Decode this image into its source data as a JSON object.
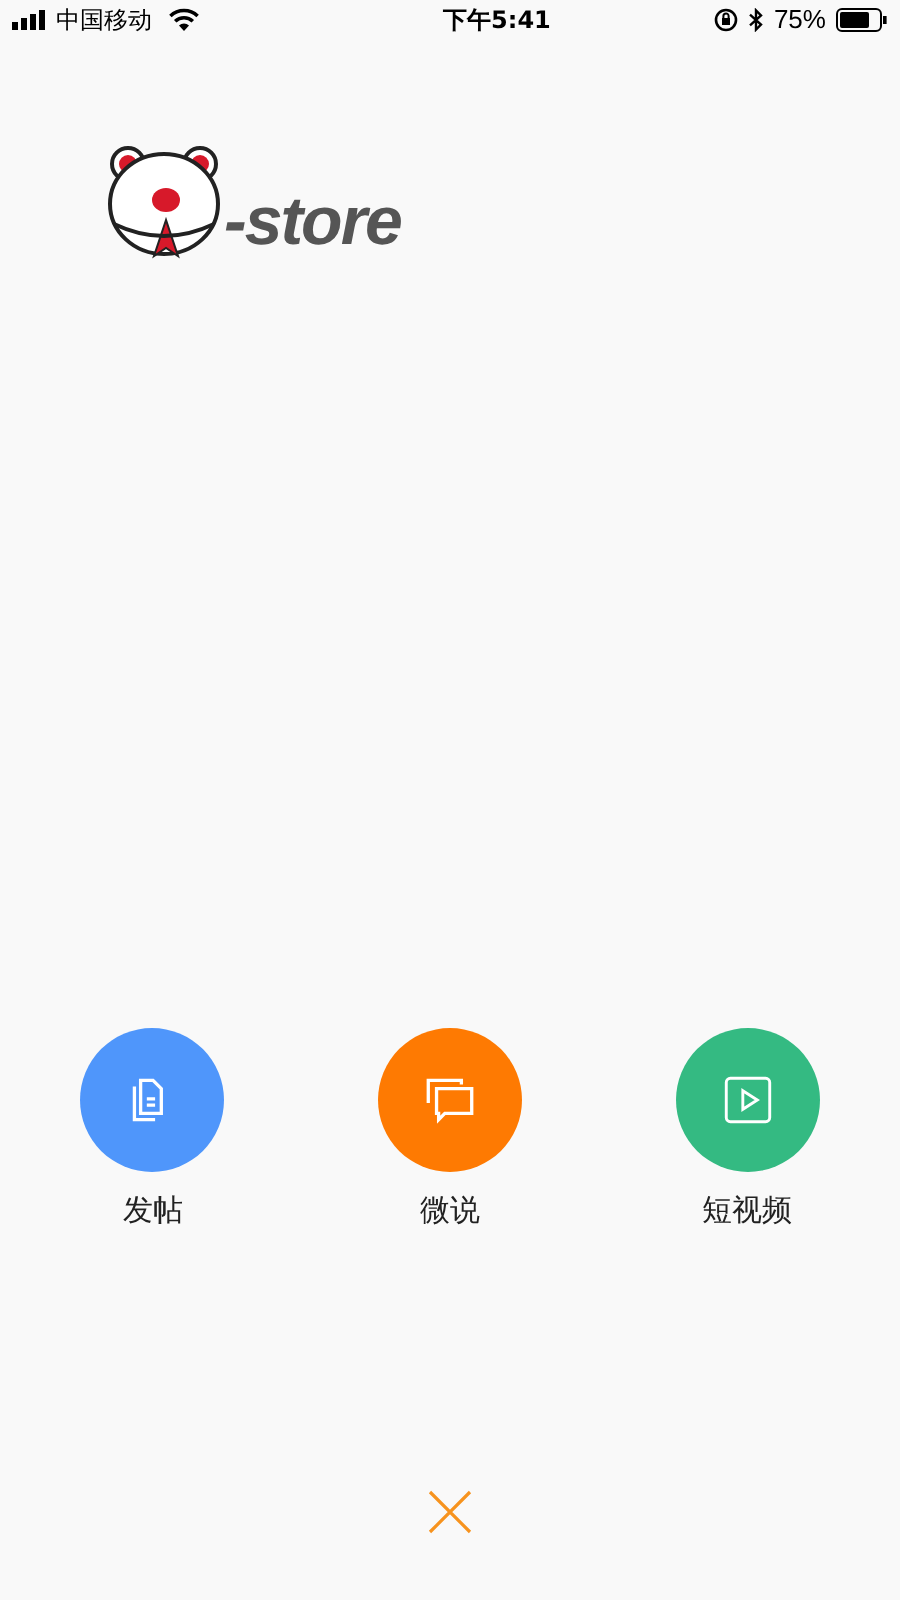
{
  "status_bar": {
    "carrier": "中国移动",
    "time": "下午5:41",
    "battery": "75%"
  },
  "logo": {
    "text": "-store"
  },
  "actions": [
    {
      "label": "发帖",
      "kind": "post",
      "color": "#4f96fb"
    },
    {
      "label": "微说",
      "kind": "chat",
      "color": "#fe7a02"
    },
    {
      "label": "短视频",
      "kind": "video",
      "color": "#34ba82"
    }
  ]
}
